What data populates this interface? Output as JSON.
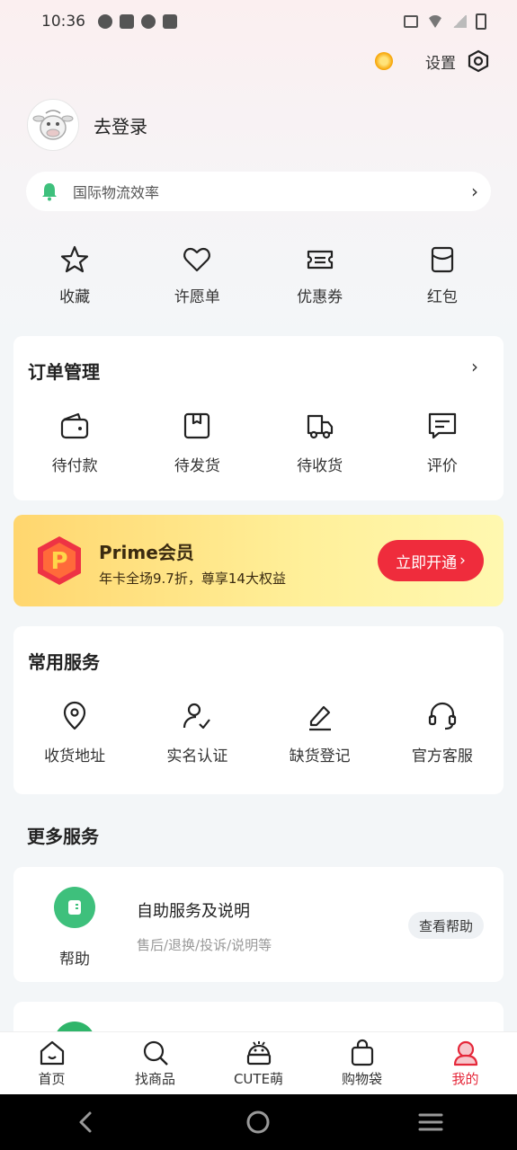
{
  "status_bar": {
    "time": "10:36"
  },
  "header": {
    "settings_label": "设置"
  },
  "profile": {
    "login_label": "去登录"
  },
  "notice": {
    "text": "国际物流效率"
  },
  "quick": [
    {
      "label": "收藏",
      "icon": "star-icon"
    },
    {
      "label": "许愿单",
      "icon": "heart-icon"
    },
    {
      "label": "优惠券",
      "icon": "ticket-icon"
    },
    {
      "label": "红包",
      "icon": "envelope-icon"
    }
  ],
  "orders": {
    "title": "订单管理",
    "items": [
      {
        "label": "待付款",
        "icon": "wallet-icon"
      },
      {
        "label": "待发货",
        "icon": "package-icon"
      },
      {
        "label": "待收货",
        "icon": "truck-icon"
      },
      {
        "label": "评价",
        "icon": "review-icon"
      }
    ]
  },
  "prime": {
    "title": "Prime会员",
    "subtitle": "年卡全场9.7折，尊享14大权益",
    "button": "立即开通",
    "logo_letter": "P"
  },
  "services": {
    "title": "常用服务",
    "items": [
      {
        "label": "收货地址",
        "icon": "location-icon"
      },
      {
        "label": "实名认证",
        "icon": "user-verify-icon"
      },
      {
        "label": "缺货登记",
        "icon": "pencil-icon"
      },
      {
        "label": "官方客服",
        "icon": "headset-icon"
      }
    ]
  },
  "more": {
    "title": "更多服务",
    "help": {
      "label": "帮助",
      "title": "自助服务及说明",
      "subtitle": "售后/退换/投诉/说明等",
      "button": "查看帮助"
    }
  },
  "nav": {
    "items": [
      {
        "label": "首页",
        "icon": "home-icon"
      },
      {
        "label": "找商品",
        "icon": "search-icon"
      },
      {
        "label": "CUTE萌",
        "icon": "cute-icon"
      },
      {
        "label": "购物袋",
        "icon": "bag-icon"
      },
      {
        "label": "我的",
        "icon": "profile-icon",
        "active": true
      }
    ]
  },
  "colors": {
    "accent": "#e5283a",
    "prime_button": "#ef2c3c",
    "help_green": "#3ec07c"
  }
}
